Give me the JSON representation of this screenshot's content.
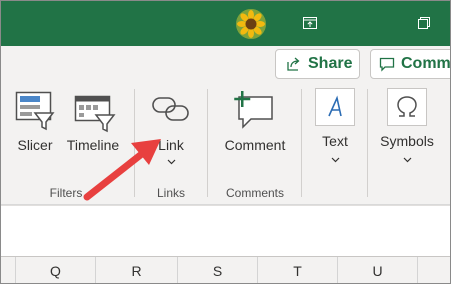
{
  "titlebar": {
    "bg_color": "#217346",
    "avatar_icon": "sunflower-avatar",
    "restore_icon": "restore-window-icon",
    "ribbon_display_icon": "ribbon-display-options-icon"
  },
  "top_buttons": {
    "share_label": "Share",
    "comments_label": "Comm"
  },
  "ribbon": {
    "items": {
      "slicer": "Slicer",
      "timeline": "Timeline",
      "link": "Link",
      "comment": "Comment",
      "text": "Text",
      "symbols": "Symbols"
    },
    "groups": {
      "filters": "Filters",
      "links": "Links",
      "comments": "Comments"
    }
  },
  "columns": [
    "Q",
    "R",
    "S",
    "T",
    "U"
  ],
  "annotation": {
    "arrow_color": "#e8403f"
  }
}
